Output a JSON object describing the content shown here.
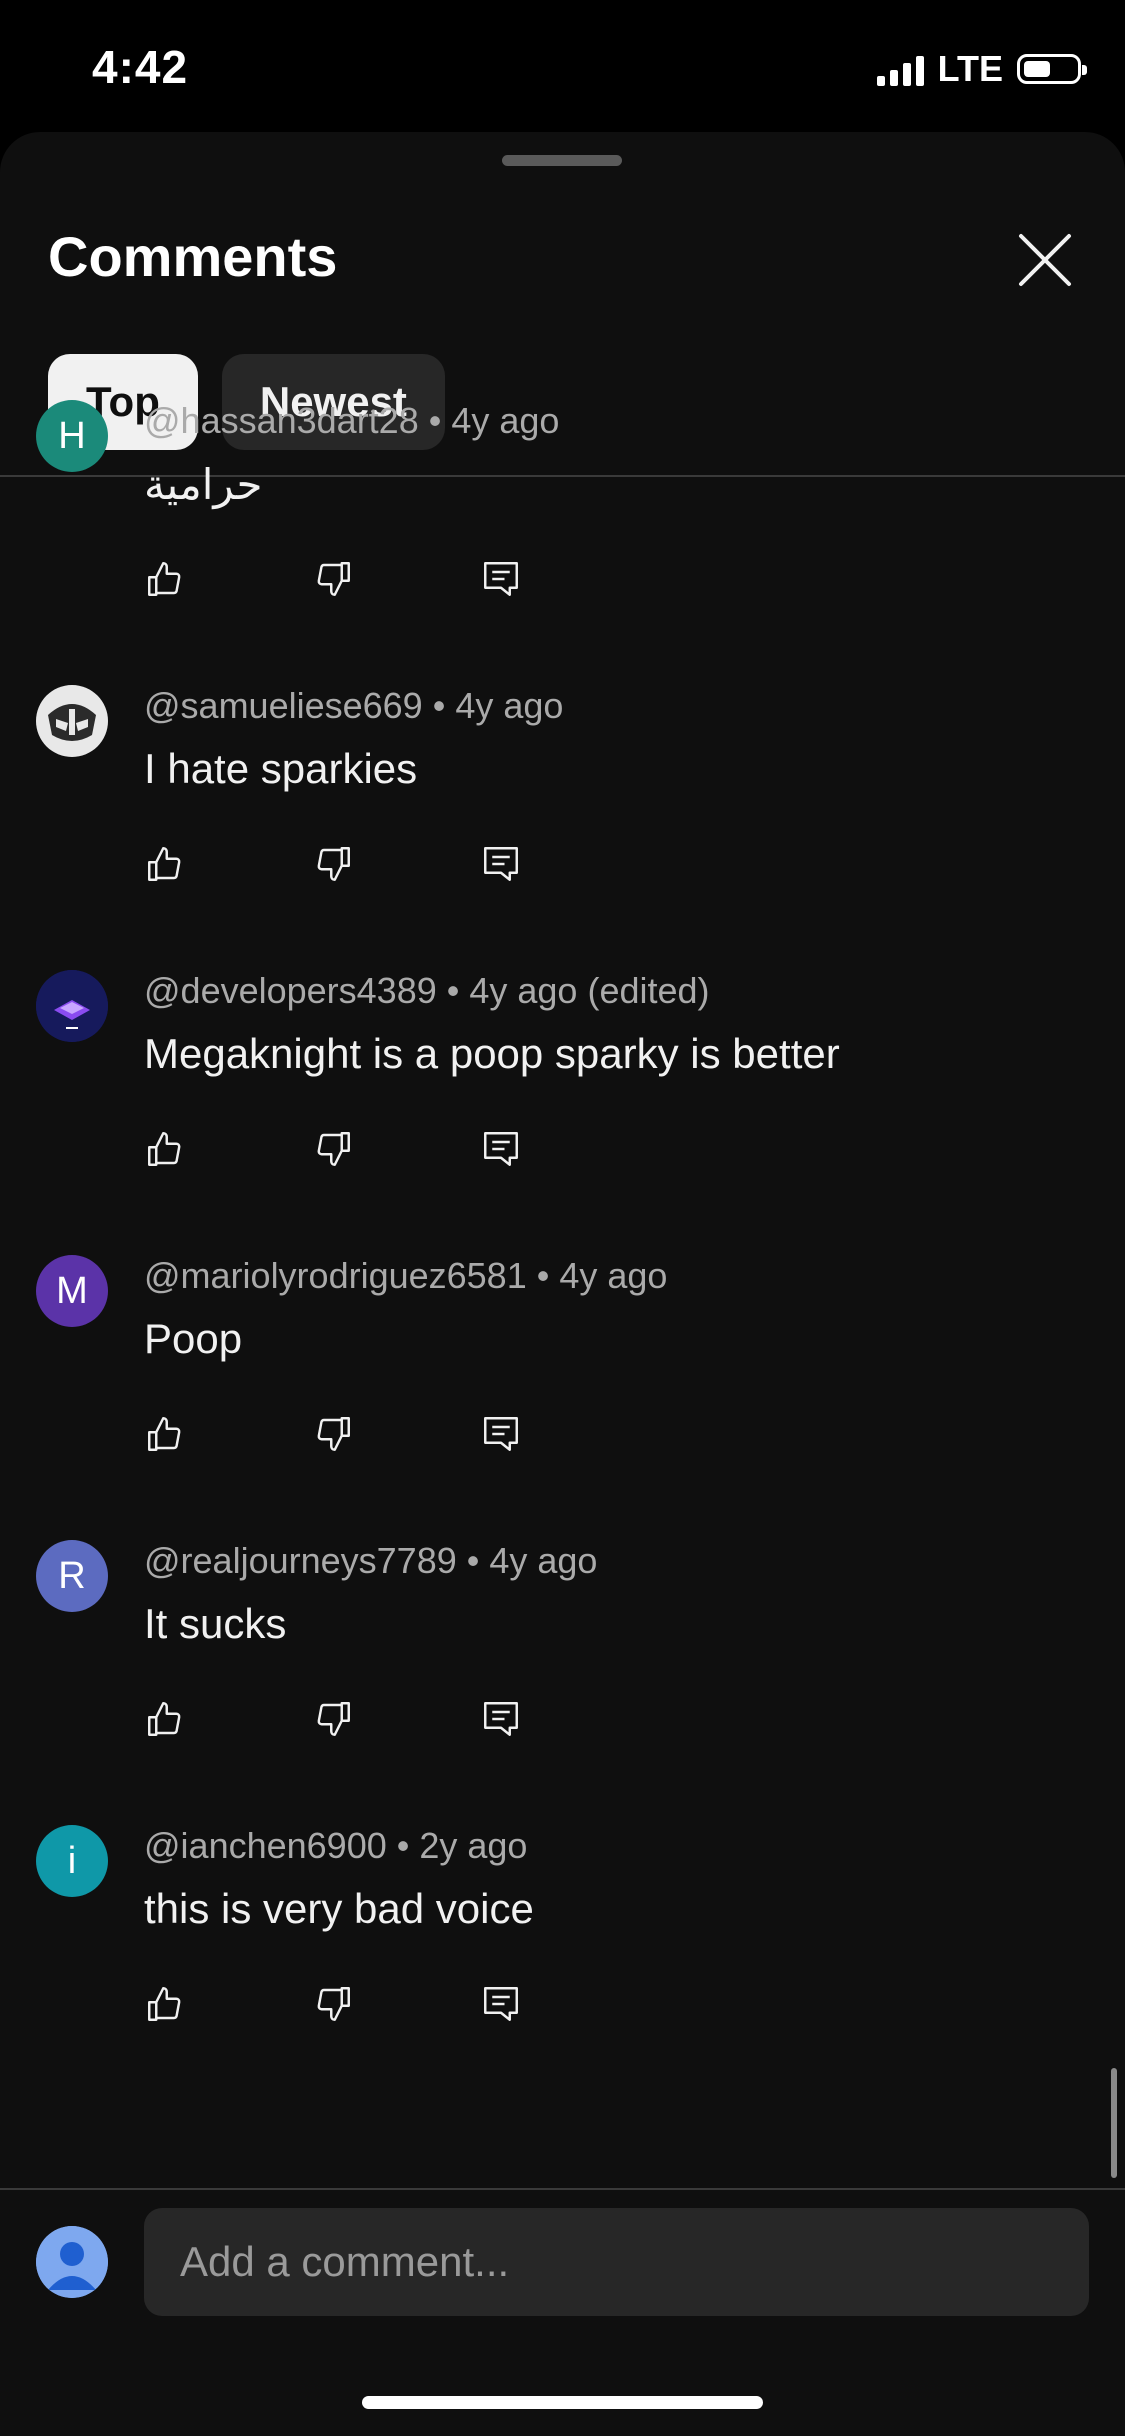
{
  "status_bar": {
    "time": "4:42",
    "network": "LTE"
  },
  "sheet": {
    "title": "Comments",
    "close_icon": "close-icon",
    "tabs": [
      {
        "label": "Top",
        "selected": true
      },
      {
        "label": "Newest",
        "selected": false
      }
    ]
  },
  "comments": [
    {
      "author": "@hassan3dart28",
      "time": "4y ago",
      "text": "حرامية",
      "avatar": {
        "letter": "H",
        "color": "#1b8a7a"
      }
    },
    {
      "author": "@samueliese669",
      "time": "4y ago",
      "text": "I hate sparkies",
      "avatar": {
        "letter": "",
        "color": "#2a2a2a"
      }
    },
    {
      "author": "@developers4389",
      "time": "4y ago (edited)",
      "text": "Megaknight is a poop sparky is better",
      "avatar": {
        "letter": "",
        "color": "#161a5c"
      }
    },
    {
      "author": "@mariolyrodriguez6581",
      "time": "4y ago",
      "text": "Poop",
      "avatar": {
        "letter": "M",
        "color": "#5b33a8"
      }
    },
    {
      "author": "@realjourneys7789",
      "time": "4y ago",
      "text": "It sucks",
      "avatar": {
        "letter": "R",
        "color": "#5c6bc0"
      }
    },
    {
      "author": "@ianchen6900",
      "time": "2y ago",
      "text": "this is very bad voice",
      "avatar": {
        "letter": "i",
        "color": "#0f98a8"
      }
    }
  ],
  "actions": {
    "like_icon": "thumbs-up-icon",
    "dislike_icon": "thumbs-down-icon",
    "reply_icon": "reply-icon"
  },
  "composer": {
    "placeholder": "Add a comment...",
    "avatar_icon": "user-avatar-icon"
  }
}
